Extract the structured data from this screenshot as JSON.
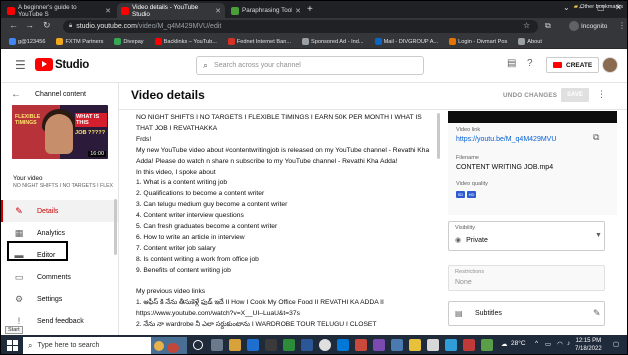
{
  "browser": {
    "tabs": [
      {
        "label": "A beginner's guide to YouTube S",
        "color": "#ff0000"
      },
      {
        "label": "Video details - YouTube Studio",
        "color": "#ff0000"
      },
      {
        "label": "Paraphrasing Tool | QuillBot AI",
        "color": "#4a9e3a"
      }
    ],
    "url_host": "studio.youtube.com",
    "url_path": "/video/M_q4M429MVU/edit",
    "incognito_label": "Incognito",
    "bookmarks": [
      {
        "label": "g@123456",
        "color": "#4285f4"
      },
      {
        "label": "FXTM Partners",
        "color": "#f2a81d"
      },
      {
        "label": "Divepay",
        "color": "#34a853"
      },
      {
        "label": "Backlinks – YouTub...",
        "color": "#ff0000"
      },
      {
        "label": "Fednet Internet Ban...",
        "color": "#d93025"
      },
      {
        "label": "Sponsored Ad - Ind...",
        "color": "#9aa0a6"
      },
      {
        "label": "Mail - DIVGROUP A...",
        "color": "#0a66c2"
      },
      {
        "label": "Login - Divmart Pos",
        "color": "#e37400"
      },
      {
        "label": "About",
        "color": "#9aa0a6"
      }
    ],
    "other_bookmarks": "Other bookmarks"
  },
  "studio": {
    "logo_text": "Studio",
    "search_placeholder": "Search across your channel",
    "create_label": "CREATE"
  },
  "sidebar": {
    "back_label": "Channel content",
    "thumbnail": {
      "left_text": "FLEXIBLE TIMINGS",
      "right_top": "WHAT IS THIS",
      "right_bottom": "JOB ?????",
      "duration": "16:00"
    },
    "your_video_label": "Your video",
    "video_title": "NO NIGHT SHIFTS I NO TARGETS I FLEXIBLE...",
    "items": [
      {
        "label": "Details",
        "icon": "pencil-icon",
        "active": true
      },
      {
        "label": "Analytics",
        "icon": "analytics-icon",
        "active": false
      },
      {
        "label": "Editor",
        "icon": "editor-icon",
        "active": false
      },
      {
        "label": "Comments",
        "icon": "comments-icon",
        "active": false
      },
      {
        "label": "Settings",
        "icon": "gear-icon",
        "active": false
      },
      {
        "label": "Send feedback",
        "icon": "feedback-icon",
        "active": false
      }
    ],
    "start_tooltip": "Start"
  },
  "main": {
    "title": "Video details",
    "undo_label": "UNDO CHANGES",
    "save_label": "SAVE",
    "description_lines": [
      "NO NIGHT SHIFTS I NO TARGETS I FLEXIBLE TIMINGS I EARN 50K PER MONTH I WHAT IS THAT JOB I REVATHAKKA",
      "Frds!",
      "My new YouTube video about #contentwritingjob is released on my YouTube channel - Revathi Kha Adda! Please do watch n share n subscribe to my YouTube channel  - Revathi Kha Adda!",
      "In this video, I spoke about",
      "1. What is a content writing job",
      "2. Qualifications to become a content writer",
      "3. Can telugu medium guy become a content writer",
      "4. Content writer interview questions",
      "5. Can fresh graduates become a content writer",
      "6. How to write an article in interview",
      "7. Content writer job salary",
      "8. Is content writing a work from office job",
      "9. Benefits of content writing job",
      "",
      "My previous video links",
      "1. ఆఫీస్ కి నేను తీసుకెళ్లే ఫుడ్ ఇదే II How I Cook My Office Food II REVATHI KA ADDA II",
      "https://www.youtube.com/watch?v=X__UI–LuaU&t=37s",
      "2. నేను నా wardrobe నీ ఎలా సర్దుకుంటాను I WARDROBE TOUR TELUGU I CLOSET"
    ],
    "right_panel": {
      "video_link_label": "Video link",
      "video_link": "https://youtu.be/M_q4M429MVU",
      "filename_label": "Filename",
      "filename": "CONTENT WRITING JOB.mp4",
      "video_quality_label": "Video quality",
      "quality_badges": [
        "SD",
        "HD"
      ],
      "visibility_label": "Visibility",
      "visibility_value": "Private",
      "restrictions_label": "Restrictions",
      "restrictions_value": "None",
      "subtitles_label": "Subtitles"
    }
  },
  "taskbar": {
    "search_placeholder": "Type here to search",
    "temperature": "28°C",
    "time": "12:15 PM",
    "date": "7/18/2022"
  }
}
